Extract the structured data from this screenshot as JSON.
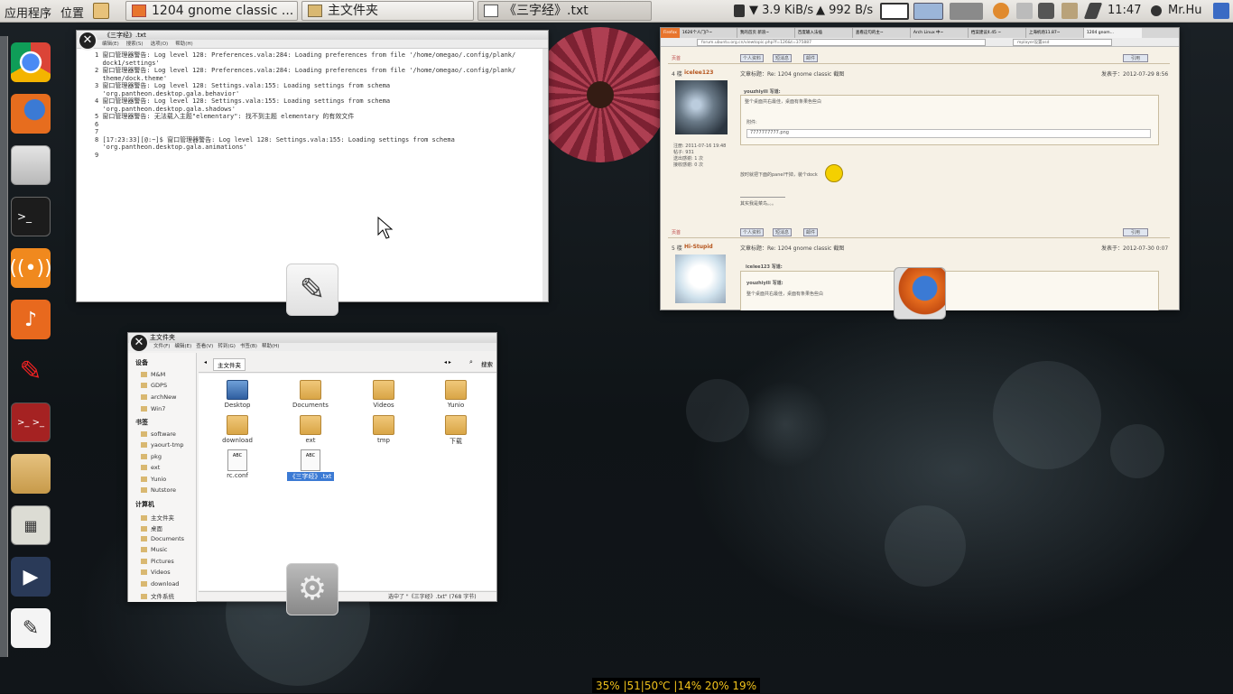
{
  "panel": {
    "apps_menu": "应用程序",
    "places_menu": "位置",
    "tasks": [
      "1204 gnome classic ...",
      "主文件夹",
      "《三字经》.txt"
    ],
    "net_down": "3.9 KiB/s",
    "net_up": "992 B/s",
    "clock": "11:47",
    "user": "Mr.Hu"
  },
  "dock": {
    "items": [
      "chrome-icon",
      "firefox-icon",
      "files-icon",
      "terminal-icon",
      "network-icon",
      "music-icon",
      "pen-icon",
      "dual-terminal-icon",
      "home-folder-icon",
      "calculator-icon",
      "video-icon",
      "text-editor-icon"
    ]
  },
  "editor": {
    "title": "《三字经》.txt",
    "menu": [
      "编辑(E)",
      "搜索(S)",
      "选项(O)",
      "帮助(H)"
    ],
    "lines": [
      "1 窗口管理器警告: Log level 128: Preferences.vala:284: Loading preferences from file '/home/omegao/.config/plank/",
      "  dock1/settings'",
      "2 窗口管理器警告: Log level 128: Preferences.vala:284: Loading preferences from file '/home/omegao/.config/plank/",
      "  theme/dock.theme'",
      "3 窗口管理器警告: Log level 128: Settings.vala:155: Loading settings from schema",
      "  'org.pantheon.desktop.gala.behavior'",
      "4 窗口管理器警告: Log level 128: Settings.vala:155: Loading settings from schema",
      "  'org.pantheon.desktop.gala.shadows'",
      "5 窗口管理器警告: 无法载入主题\"elementary\": 找不到主题 elementary 的有效文件",
      "6",
      "7",
      "8 [17:23:33][@:~]$ 窗口管理器警告: Log level 128: Settings.vala:155: Loading settings from schema",
      "  'org.pantheon.desktop.gala.animations'",
      "9"
    ]
  },
  "browser": {
    "tabs": [
      "1626个人门户~",
      "我的首页 新浪~",
      "百度输入法插",
      "查看这句的主~",
      "Arch Linux 中~",
      "档案建议4.45 ~",
      "上海机场11.87~",
      "1204 gnom..."
    ],
    "url": "forum.ubuntu.org.cn/viewtopic.php?f=126&t=375887",
    "search": "mplayer设置osd",
    "post4_user": "icelee123",
    "post4_title": "文章标题：Re: 1204 gnome classic 截图",
    "post4_date": "发表于：2012-07-29 8:56",
    "post4_quote_author": "youzhiyili 写道:",
    "post4_quote": "整个桌面共右最佳，桌面有条果色些白",
    "post4_attach": "附件:",
    "post4_file": "7777777777.png",
    "post4_body": "放时就把下面的panel干掉，装个dock",
    "post4_body2": "其实我是菜鸟。。。",
    "post4_meta": [
      "注册: 2011-07-16 19:48",
      "帖子: 931",
      "送出感谢: 1 次",
      "接收感谢: 0 次"
    ],
    "post5_user": "Hi-Stupid",
    "post5_title": "文章标题：Re: 1204 gnome classic 截图",
    "post5_date": "发表于：2012-07-30 0:07",
    "post5_quote1": "icelee123 写道:",
    "post5_quote2": "youzhiyili 写道:",
    "post5_quote3": "整个桌面共右最佳，桌面有条果色些白",
    "page_top": "页首",
    "buttons": [
      "个人资料",
      "短消息",
      "邮件"
    ],
    "quote_btn": "引用",
    "post4_num": "4 楼",
    "post5_num": "5 楼"
  },
  "files": {
    "title": "主文件夹",
    "menu": [
      "文件(F)",
      "编辑(E)",
      "查看(V)",
      "转到(G)",
      "书签(B)",
      "帮助(H)"
    ],
    "location": "主文件夹",
    "search_label": "搜索",
    "sidebar": {
      "devices_header": "设备",
      "devices": [
        "M&M",
        "GDPS",
        "archNew",
        "Win7"
      ],
      "bookmarks_header": "书签",
      "bookmarks": [
        "software",
        "yaourt-tmp",
        "pkg",
        "ext",
        "Yunio",
        "Nutstore"
      ],
      "computer_header": "计算机",
      "computer": [
        "主文件夹",
        "桌面",
        "Documents",
        "Music",
        "Pictures",
        "Videos",
        "download",
        "文件系统"
      ]
    },
    "items": [
      "Desktop",
      "Documents",
      "Videos",
      "Yunio",
      "download",
      "ext",
      "tmp",
      "下载",
      "rc.conf",
      "《三字经》.txt"
    ],
    "status": "选中了 \"《三字经》.txt\" (768 字节)"
  },
  "status_bar": "35% |51|50℃ |14% 20% 19%"
}
